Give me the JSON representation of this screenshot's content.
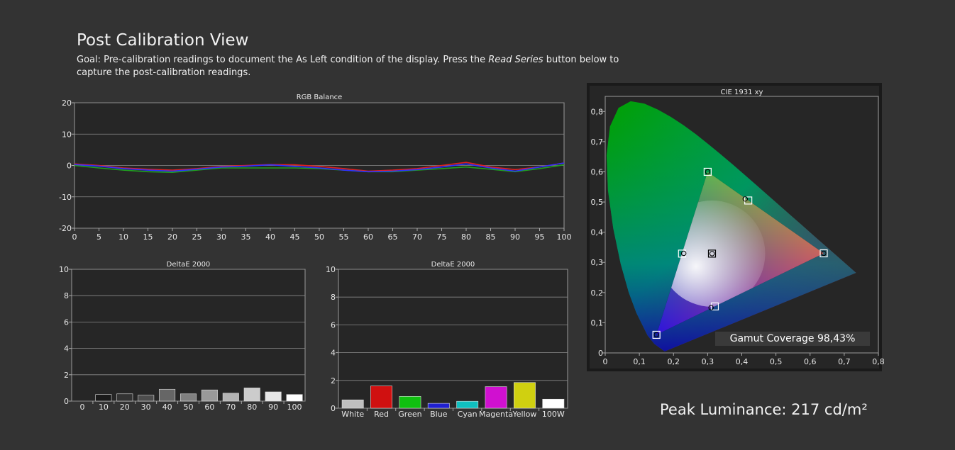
{
  "header": {
    "title": "Post Calibration View",
    "goal_pre": "Goal: Pre-calibration readings to document the As Left condition of the display. Press the ",
    "goal_em": "Read Series",
    "goal_post": " button below to capture the post-calibration readings."
  },
  "peak_luminance": "Peak Luminance: 217 cd/m²",
  "chart_data": [
    {
      "id": "rgb",
      "type": "line",
      "title": "RGB Balance",
      "x": [
        0,
        5,
        10,
        15,
        20,
        25,
        30,
        35,
        40,
        45,
        50,
        55,
        60,
        65,
        70,
        75,
        80,
        85,
        90,
        95,
        100
      ],
      "xticks": [
        "0",
        "5",
        "10",
        "15",
        "20",
        "25",
        "30",
        "35",
        "40",
        "45",
        "50",
        "55",
        "60",
        "65",
        "70",
        "75",
        "80",
        "85",
        "90",
        "95",
        "100"
      ],
      "ylim": [
        -20,
        20
      ],
      "yticks": [
        "20",
        "10",
        "0",
        "-10",
        "-20"
      ],
      "series": [
        {
          "color": "#e02020",
          "values": [
            0.5,
            0,
            -0.8,
            -1.2,
            -1.5,
            -1.0,
            -0.3,
            0,
            0.3,
            0.2,
            -0.3,
            -1.0,
            -1.8,
            -1.5,
            -1.0,
            0,
            1.0,
            -0.5,
            -1.3,
            -0.5,
            0.8
          ]
        },
        {
          "color": "#20a020",
          "values": [
            0,
            -0.8,
            -1.5,
            -2.0,
            -2.2,
            -1.5,
            -0.8,
            -0.8,
            -0.8,
            -0.8,
            -1.0,
            -1.5,
            -2.0,
            -2.0,
            -1.5,
            -1.0,
            -0.5,
            -1.2,
            -2.0,
            -1.0,
            0.2
          ]
        },
        {
          "color": "#3030ff",
          "values": [
            0.3,
            -0.2,
            -1.0,
            -1.5,
            -1.8,
            -1.2,
            -0.5,
            -0.2,
            0.2,
            -0.3,
            -0.8,
            -1.5,
            -2.0,
            -1.8,
            -1.3,
            -0.5,
            0.5,
            -0.8,
            -1.8,
            -0.5,
            0.8
          ]
        }
      ]
    },
    {
      "id": "de-gray",
      "type": "bar",
      "title": "DeltaE 2000",
      "categories": [
        "0",
        "10",
        "20",
        "30",
        "40",
        "50",
        "60",
        "70",
        "80",
        "90",
        "100"
      ],
      "values": [
        0,
        0.5,
        0.55,
        0.45,
        0.9,
        0.55,
        0.85,
        0.6,
        1.0,
        0.7,
        0.5
      ],
      "colors": [
        "#000000",
        "#1a1a1a",
        "#333333",
        "#4d4d4d",
        "#666666",
        "#808080",
        "#999999",
        "#b3b3b3",
        "#cccccc",
        "#e6e6e6",
        "#ffffff"
      ],
      "ylim": [
        0,
        10
      ],
      "yticks": [
        "10",
        "8",
        "6",
        "4",
        "2",
        "0"
      ]
    },
    {
      "id": "de-color",
      "type": "bar",
      "title": "DeltaE 2000",
      "categories": [
        "White",
        "Red",
        "Green",
        "Blue",
        "Cyan",
        "Magenta",
        "Yellow",
        "100W"
      ],
      "values": [
        0.6,
        1.6,
        0.85,
        0.35,
        0.5,
        1.55,
        1.85,
        0.65
      ],
      "colors": [
        "#bfbfbf",
        "#d01010",
        "#10c010",
        "#2020d0",
        "#10c0c0",
        "#d010d0",
        "#d0d010",
        "#ffffff"
      ],
      "ylim": [
        0,
        10
      ],
      "yticks": [
        "10",
        "8",
        "6",
        "4",
        "2",
        "0"
      ]
    },
    {
      "id": "cie",
      "type": "scatter",
      "title": "CIE 1931 xy",
      "xlim": [
        0,
        0.8
      ],
      "ylim": [
        0,
        0.85
      ],
      "xticks": [
        "0",
        "0,1",
        "0,2",
        "0,3",
        "0,4",
        "0,5",
        "0,6",
        "0,7",
        "0,8"
      ],
      "yticks": [
        "0",
        "0,1",
        "0,2",
        "0,3",
        "0,4",
        "0,5",
        "0,6",
        "0,7",
        "0,8"
      ],
      "targets": [
        {
          "x": 0.64,
          "y": 0.33
        },
        {
          "x": 0.3,
          "y": 0.6
        },
        {
          "x": 0.15,
          "y": 0.06
        },
        {
          "x": 0.419,
          "y": 0.505
        },
        {
          "x": 0.225,
          "y": 0.329
        },
        {
          "x": 0.321,
          "y": 0.154
        },
        {
          "x": 0.3127,
          "y": 0.329
        }
      ],
      "measured": [
        {
          "x": 0.64,
          "y": 0.33
        },
        {
          "x": 0.3,
          "y": 0.6
        },
        {
          "x": 0.15,
          "y": 0.06
        },
        {
          "x": 0.41,
          "y": 0.51
        },
        {
          "x": 0.23,
          "y": 0.33
        },
        {
          "x": 0.31,
          "y": 0.15
        },
        {
          "x": 0.313,
          "y": 0.329
        }
      ],
      "gamut_coverage": "Gamut Coverage 98,43%"
    }
  ]
}
